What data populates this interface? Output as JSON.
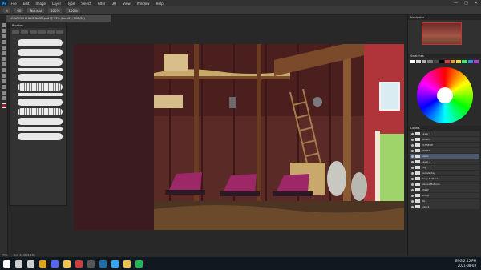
{
  "app": {
    "logo": "Ps"
  },
  "menu": [
    "File",
    "Edit",
    "Image",
    "Layer",
    "Type",
    "Select",
    "Filter",
    "3D",
    "View",
    "Window",
    "Help"
  ],
  "window_controls": [
    "—",
    "□",
    "✕"
  ],
  "options_bar": {
    "size": "60",
    "mode": "Normal",
    "opacity": "100%",
    "flow": "100%"
  },
  "document_tab": {
    "title": "LOCATION CHAKE BARN.psd @ 33% (barn01, RGB/8*)"
  },
  "brushes_panel": {
    "title": "Brushes"
  },
  "right_panels": {
    "navigator_tab": "Navigator",
    "swatches_tab": "Swatches",
    "layers_tab": "Layers"
  },
  "layers": [
    {
      "name": "Layer 1",
      "sel": false
    },
    {
      "name": "lantern",
      "sel": false
    },
    {
      "name": "CLOSEUP",
      "sel": false
    },
    {
      "name": "FRONT",
      "sel": false
    },
    {
      "name": "stand",
      "sel": true
    },
    {
      "name": "Layer 2",
      "sel": false
    },
    {
      "name": "hay",
      "sel": false
    },
    {
      "name": "barrels day",
      "sel": false
    },
    {
      "name": "Frozy Buttons",
      "sel": false
    },
    {
      "name": "Sleeve Buttons",
      "sel": false
    },
    {
      "name": "Sheet",
      "sel": false
    },
    {
      "name": "Group",
      "sel": false
    },
    {
      "name": "BG",
      "sel": false
    },
    {
      "name": "plan 2",
      "sel": false
    }
  ],
  "status": {
    "zoom": "33%",
    "doc": "Doc: 44.9M/1.93G"
  },
  "taskbar": {
    "time": "2:55 PM",
    "date": "2021-08-03",
    "lang": "ENG",
    "icons": [
      {
        "name": "start-icon",
        "color": "#ffffff"
      },
      {
        "name": "search-icon",
        "color": "#cfcfcf"
      },
      {
        "name": "taskview-icon",
        "color": "#cfcfcf"
      },
      {
        "name": "chrome-icon",
        "color": "#e4a11b"
      },
      {
        "name": "discord-icon",
        "color": "#5865f2"
      },
      {
        "name": "folder-icon",
        "color": "#f2c24f"
      },
      {
        "name": "media-icon",
        "color": "#d23b3b"
      },
      {
        "name": "obs-icon",
        "color": "#555555"
      },
      {
        "name": "steam-icon",
        "color": "#1b6fa8"
      },
      {
        "name": "photoshop-icon",
        "color": "#31a8ff"
      },
      {
        "name": "clip-icon",
        "color": "#e8c54a"
      },
      {
        "name": "spotify-icon",
        "color": "#1db954"
      }
    ]
  }
}
